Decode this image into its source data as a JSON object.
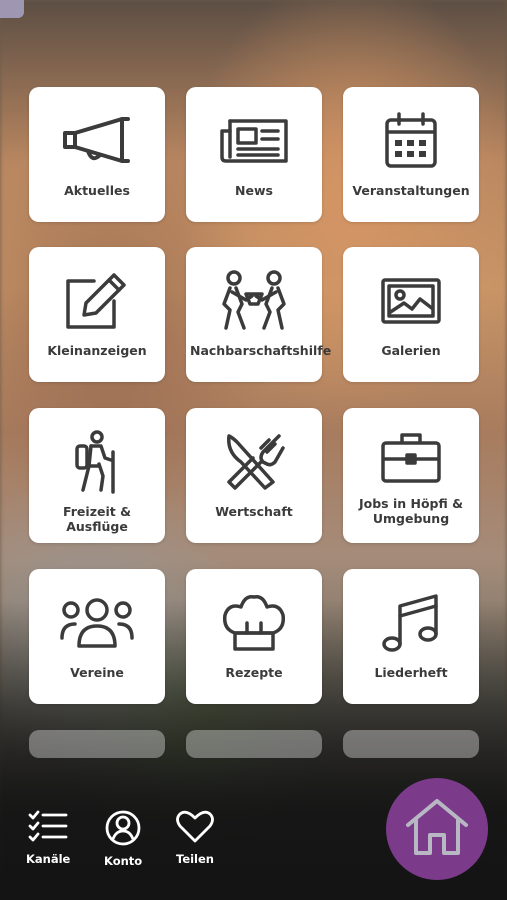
{
  "tiles": [
    {
      "label": "Aktuelles",
      "icon": "megaphone-icon"
    },
    {
      "label": "News",
      "icon": "newspaper-icon"
    },
    {
      "label": "Veranstaltungen",
      "icon": "calendar-icon"
    },
    {
      "label": "Kleinanzeigen",
      "icon": "edit-icon"
    },
    {
      "label": "Nachbarschaftshilfe",
      "icon": "helping-people-icon"
    },
    {
      "label": "Galerien",
      "icon": "image-icon"
    },
    {
      "label": "Freizeit & Ausflüge",
      "icon": "hiker-icon"
    },
    {
      "label": "Wertschaft",
      "icon": "fork-knife-icon"
    },
    {
      "label": "Jobs in Höpfi & Umgebung",
      "icon": "briefcase-icon"
    },
    {
      "label": "Vereine",
      "icon": "group-icon"
    },
    {
      "label": "Rezepte",
      "icon": "chef-hat-icon"
    },
    {
      "label": "Liederheft",
      "icon": "music-note-icon"
    }
  ],
  "nav": {
    "channels_label": "Kanäle",
    "account_label": "Konto",
    "share_label": "Teilen"
  },
  "colors": {
    "accent": "#7b3a8a",
    "icon": "#3b3b3b"
  }
}
